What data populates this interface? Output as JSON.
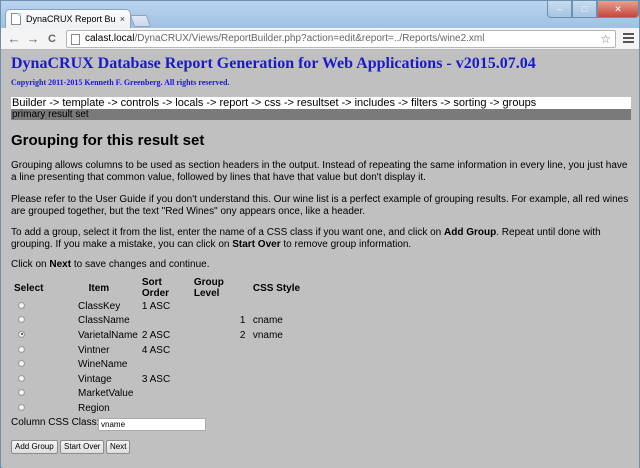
{
  "browser": {
    "tab_title": "DynaCRUX Report Builder",
    "tab_close": "×",
    "url_host": "calast.local",
    "url_path": "/DynaCRUX/Views/ReportBuilder.php?action=edit&report=../Reports/wine2.xml",
    "back": "←",
    "forward": "→",
    "reload": "C",
    "star": "☆",
    "win_min": "–",
    "win_max": "□",
    "win_close": "✕"
  },
  "header": {
    "title": "DynaCRUX Database Report Generation for Web Applications - v2015.07.04",
    "copyright": "Copyright 2011-2015 Kenneth F. Greenberg. All rights reserved."
  },
  "breadcrumb": {
    "items": [
      "Builder",
      "template",
      "controls",
      "locals",
      "report",
      "css",
      "resultset",
      "includes",
      "filters",
      "sorting",
      "groups"
    ],
    "separator": "->"
  },
  "subbar": "primary result set",
  "section": {
    "heading": "Grouping for this result set",
    "p1": "Grouping allows columns to be used as section headers in the output. Instead of repeating the same information in every line, you just have a line presenting that common value, followed by lines that have that value but don't display it.",
    "p2": "Please refer to the User Guide if you don't understand this. Our wine list is a perfect example of grouping results. For example, all red wines are grouped together, but the text \"Red Wines\" ony appears once, like a header.",
    "p3_a": "To add a group, select it from the list, enter the name of a CSS class if you want one, and click on ",
    "p3_b": "Add Group",
    "p3_c": ". Repeat until done with grouping. If you make a mistake, you can click on ",
    "p3_d": "Start Over",
    "p3_e": " to remove group information.",
    "p4_a": "Click on ",
    "p4_b": "Next",
    "p4_c": " to save changes and continue."
  },
  "table": {
    "headers": [
      "Select",
      "Item",
      "Sort Order",
      "Group Level",
      "CSS Style"
    ],
    "rows": [
      {
        "selected": false,
        "item": "ClassKey",
        "sort": "1 ASC",
        "level": "",
        "css": ""
      },
      {
        "selected": false,
        "item": "ClassName",
        "sort": "",
        "level": "1",
        "css": "cname"
      },
      {
        "selected": true,
        "item": "VarietalName",
        "sort": "2 ASC",
        "level": "2",
        "css": "vname"
      },
      {
        "selected": false,
        "item": "Vintner",
        "sort": "4 ASC",
        "level": "",
        "css": ""
      },
      {
        "selected": false,
        "item": "WineName",
        "sort": "",
        "level": "",
        "css": ""
      },
      {
        "selected": false,
        "item": "Vintage",
        "sort": "3 ASC",
        "level": "",
        "css": ""
      },
      {
        "selected": false,
        "item": "MarketValue",
        "sort": "",
        "level": "",
        "css": ""
      },
      {
        "selected": false,
        "item": "Region",
        "sort": "",
        "level": "",
        "css": ""
      }
    ]
  },
  "form": {
    "css_label": "Column CSS Class:",
    "css_value": "vname",
    "add_group": "Add Group",
    "start_over": "Start Over",
    "next": "Next"
  }
}
